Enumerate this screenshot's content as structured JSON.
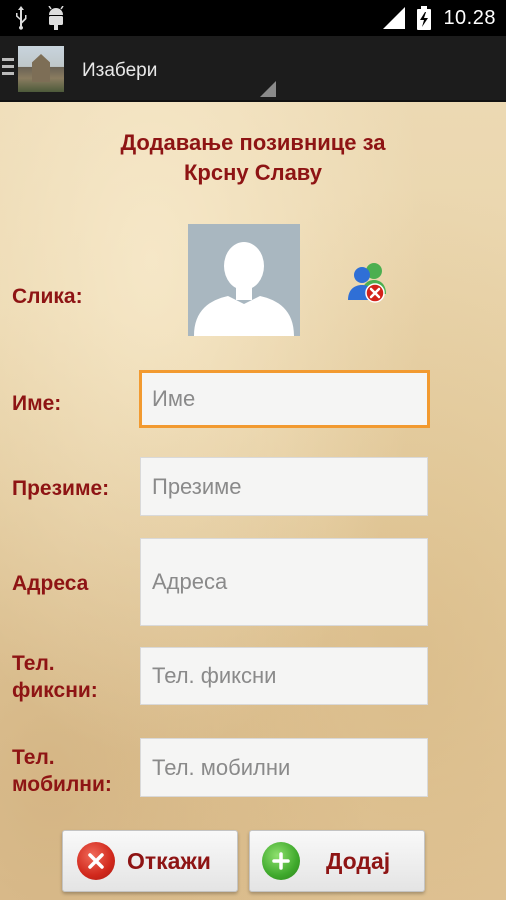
{
  "status_bar": {
    "time": "10.28",
    "icons": [
      "usb-icon",
      "android-debug-icon",
      "signal-icon",
      "battery-charging-icon"
    ]
  },
  "action_bar": {
    "title": "Изабери"
  },
  "form": {
    "heading_line1": "Додавање позивнице за",
    "heading_line2": "Крсну Славу",
    "photo_label": "Слика:",
    "name_label": "Име:",
    "name_placeholder": "Име",
    "surname_label": "Презиме:",
    "surname_placeholder": "Презиме",
    "address_label": "Адреса",
    "address_placeholder": "Адреса",
    "phone_fixed_label_line1": "Тел.",
    "phone_fixed_label_line2": "фиксни:",
    "phone_fixed_placeholder": "Тел. фиксни",
    "phone_mobile_label_line1": "Тел.",
    "phone_mobile_label_line2": "мобилни:",
    "phone_mobile_placeholder": "Тел. мобилни"
  },
  "buttons": {
    "cancel_label": "Откажи",
    "add_label": "Додај"
  },
  "colors": {
    "label_color": "#8e1414",
    "focus_border": "#f29a30",
    "cancel_icon": "#d1281c",
    "add_icon": "#3fa92c"
  }
}
